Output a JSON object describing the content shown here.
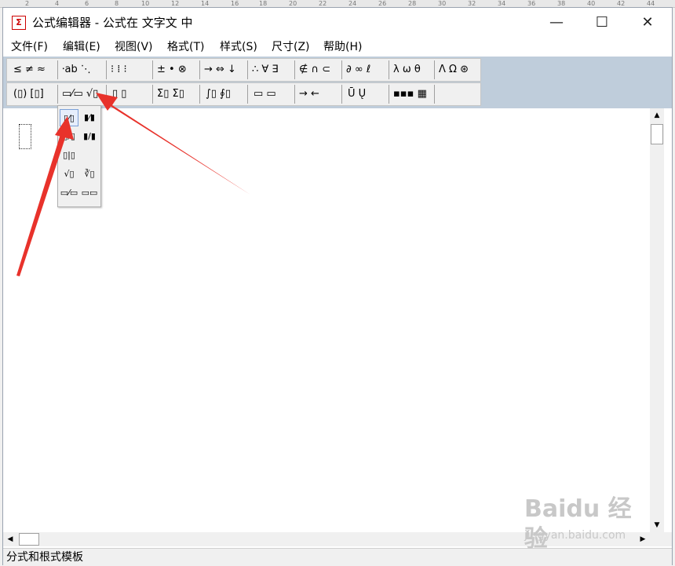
{
  "ruler": [
    "2",
    "4",
    "6",
    "8",
    "10",
    "12",
    "14",
    "16",
    "18",
    "20",
    "22",
    "24",
    "26",
    "28",
    "30",
    "32",
    "34",
    "36",
    "38",
    "40",
    "42",
    "44"
  ],
  "window": {
    "title": "公式编辑器 - 公式在 文字文 中",
    "app_icon": "Σ",
    "minimize_glyph": "—",
    "maximize_glyph": "☐",
    "close_glyph": "✕"
  },
  "menu": [
    "文件(F)",
    "编辑(E)",
    "视图(V)",
    "格式(T)",
    "样式(S)",
    "尺寸(Z)",
    "帮助(H)"
  ],
  "toolbar": {
    "row1": [
      "≤ ≠ ≈",
      "⸱ab ⋱",
      "⁝ ⁞ ⁝",
      "± • ⊗",
      "→ ⇔ ↓",
      "∴ ∀ ∃",
      "∉ ∩ ⊂",
      "∂ ∞ ℓ",
      "λ ω θ",
      "Λ Ω ⊛"
    ],
    "row2": [
      "(▯) [▯]",
      "▭⁄▭ √▯",
      "▯ ▯",
      "Σ▯ Σ▯",
      "∫▯ ∮▯",
      "▭ ▭",
      "→ ←",
      "Ū Ų",
      "▪▪▪ ▦"
    ]
  },
  "popup_items": [
    "▯⁄▯",
    "▮⁄▮",
    "▯/▯",
    "▮/▮",
    "▯|▯",
    "√▯",
    "∛▯",
    "▭⁄▭",
    "▭▭"
  ],
  "scrollbar": {
    "up": "▲",
    "down": "▼",
    "left": "◀",
    "right": "▶"
  },
  "status": "分式和根式模板",
  "watermark": {
    "brand": "Baidu 经验",
    "site": "jingyan.baidu.com"
  },
  "colors": {
    "toolbar_bg": "#bfcddb",
    "annotation": "#e8322b"
  }
}
